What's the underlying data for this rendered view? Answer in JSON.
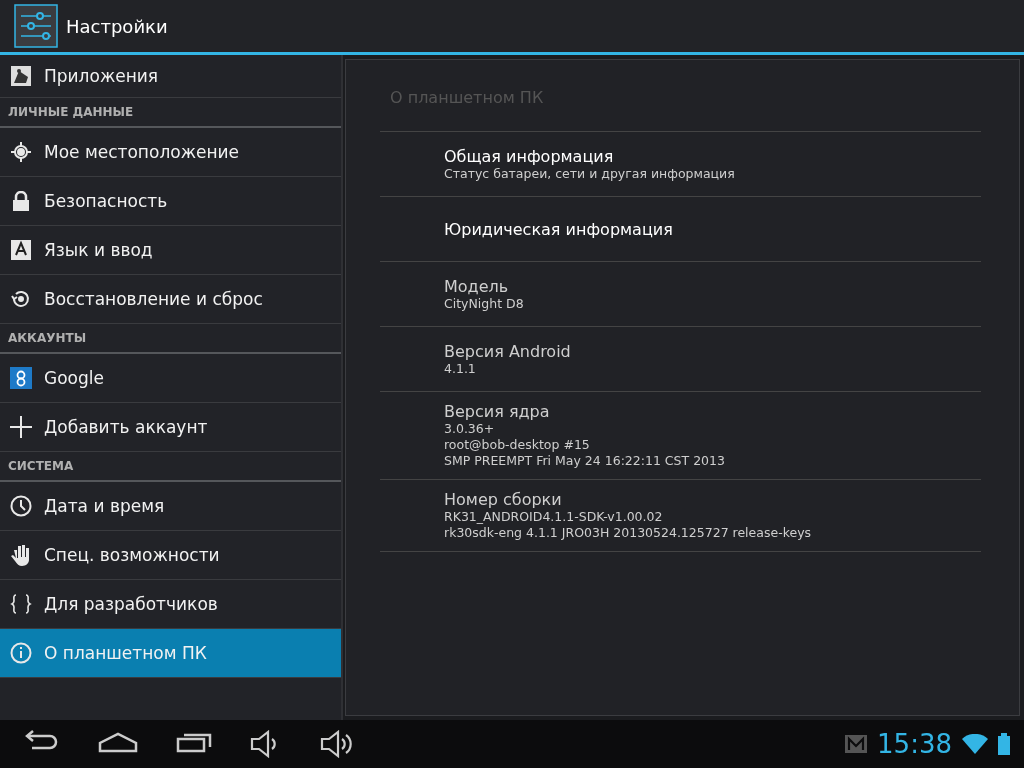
{
  "action_bar": {
    "title": "Настройки"
  },
  "sidebar": {
    "items": [
      {
        "kind": "item",
        "label": "Приложения",
        "selected": false
      },
      {
        "kind": "header",
        "label": "ЛИЧНЫЕ ДАННЫЕ"
      },
      {
        "kind": "item",
        "label": "Мое местоположение",
        "selected": false
      },
      {
        "kind": "item",
        "label": "Безопасность",
        "selected": false
      },
      {
        "kind": "item",
        "label": "Язык и ввод",
        "selected": false
      },
      {
        "kind": "item",
        "label": "Восстановление и сброс",
        "selected": false
      },
      {
        "kind": "header",
        "label": "АККАУНТЫ"
      },
      {
        "kind": "item",
        "label": "Google",
        "selected": false
      },
      {
        "kind": "item",
        "label": "Добавить аккаунт",
        "selected": false
      },
      {
        "kind": "header",
        "label": "СИСТЕМА"
      },
      {
        "kind": "item",
        "label": "Дата и время",
        "selected": false
      },
      {
        "kind": "item",
        "label": "Спец. возможности",
        "selected": false
      },
      {
        "kind": "item",
        "label": "Для разработчиков",
        "selected": false
      },
      {
        "kind": "item",
        "label": "О планшетном ПК",
        "selected": true
      }
    ]
  },
  "detail": {
    "title": "О планшетном ПК",
    "rows": [
      {
        "kind": "link",
        "title": "Общая информация",
        "lines": [
          "Статус батареи, сети и другая информация"
        ]
      },
      {
        "kind": "link",
        "title": "Юридическая информация",
        "lines": []
      },
      {
        "kind": "info",
        "title": "Модель",
        "lines": [
          "CityNight D8"
        ]
      },
      {
        "kind": "info",
        "title": "Версия Android",
        "lines": [
          "4.1.1"
        ]
      },
      {
        "kind": "info",
        "title": "Версия ядра",
        "lines": [
          "3.0.36+",
          "root@bob-desktop #15",
          "SMP PREEMPT Fri May 24 16:22:11 CST 2013"
        ]
      },
      {
        "kind": "info",
        "title": "Номер сборки",
        "lines": [
          "RK31_ANDROID4.1.1-SDK-v1.00.02",
          "rk30sdk-eng 4.1.1 JRO03H 20130524.125727 release-keys"
        ]
      }
    ]
  },
  "status_bar": {
    "time": "15:38"
  }
}
